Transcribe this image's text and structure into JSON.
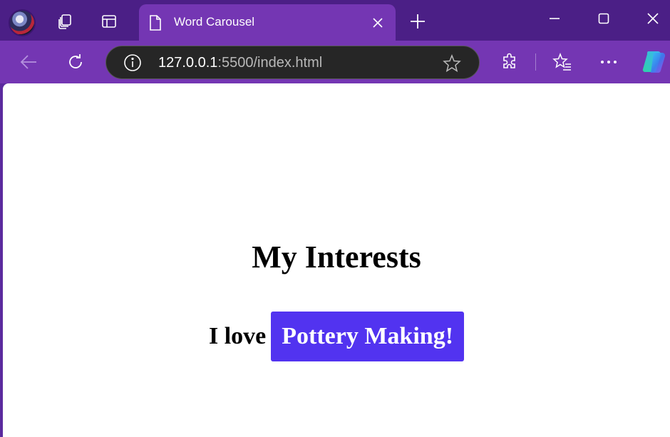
{
  "window": {
    "tab_title": "Word Carousel",
    "controls": [
      "minimize-icon",
      "maximize-icon",
      "close-icon"
    ]
  },
  "toolbar": {
    "url_host": "127.0.0.1",
    "url_rest": ":5500/index.html",
    "icons": [
      "back-arrow-icon",
      "refresh-icon",
      "info-icon",
      "star-icon",
      "extensions-icon",
      "favorites-icon",
      "more-icon",
      "copilot-icon"
    ]
  },
  "page": {
    "heading": "My Interests",
    "sentence_prefix": "I love",
    "highlighted_word": "Pottery Making!",
    "highlight_color": "#5233f0"
  },
  "theme": {
    "frame_dark": "#4b1f86",
    "frame": "#7436b3"
  }
}
